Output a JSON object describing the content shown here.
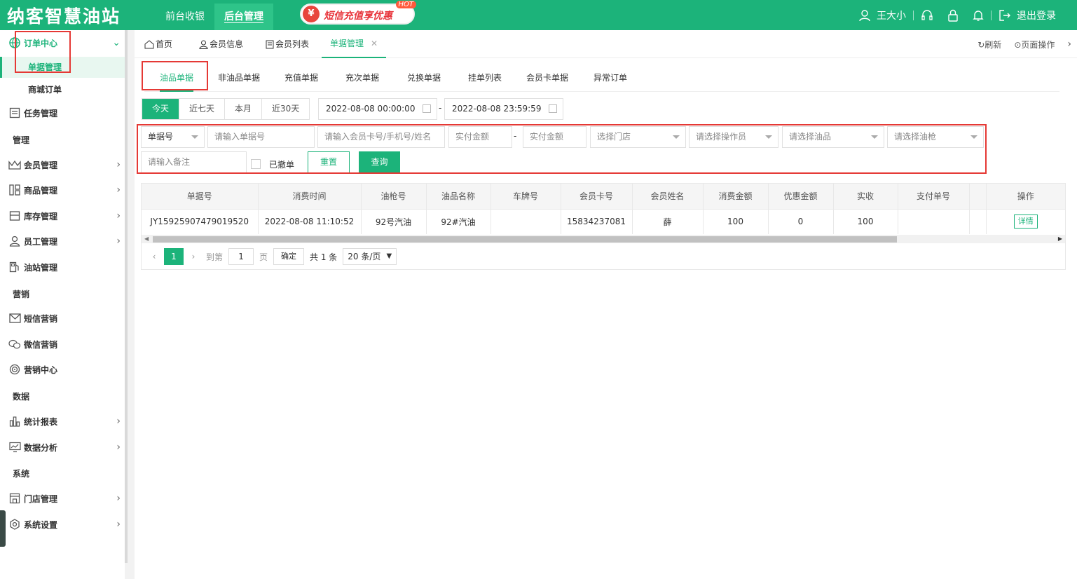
{
  "app": {
    "logo": "纳客智慧油站"
  },
  "topnav": [
    {
      "label": "前台收银"
    },
    {
      "label": "后台管理"
    }
  ],
  "promo": {
    "label": "短信充值享优惠",
    "badge": "HOT"
  },
  "user": {
    "name": "王大小",
    "logout": "退出登录"
  },
  "sidebar": {
    "order_center": "订单中心",
    "order_subs": [
      "单据管理",
      "商城订单"
    ],
    "task": "任务管理",
    "sections": [
      "管理",
      "营销",
      "数据",
      "系统"
    ],
    "manage_items": [
      "会员管理",
      "商品管理",
      "库存管理",
      "员工管理",
      "油站管理"
    ],
    "marketing_items": [
      "短信营销",
      "微信营销",
      "营销中心"
    ],
    "data_items": [
      "统计报表",
      "数据分析"
    ],
    "system_items": [
      "门店管理",
      "系统设置"
    ]
  },
  "tabs": [
    {
      "label": "首页"
    },
    {
      "label": "会员信息"
    },
    {
      "label": "会员列表"
    },
    {
      "label": "单据管理"
    }
  ],
  "tabs_right": {
    "refresh": "刷新",
    "page_ops": "页面操作"
  },
  "subtabs": [
    "油品单据",
    "非油品单据",
    "充值单据",
    "充次单据",
    "兑换单据",
    "挂单列表",
    "会员卡单据",
    "异常订单"
  ],
  "quick_range": [
    "今天",
    "近七天",
    "本月",
    "近30天"
  ],
  "date": {
    "start": "2022-08-08 00:00:00",
    "end": "2022-08-08 23:59:59",
    "sep": "-"
  },
  "filters": {
    "type_select": "单据号",
    "bill_no_ph": "请输入单据号",
    "member_ph": "请输入会员卡号/手机号/姓名",
    "amount_min_ph": "实付金额",
    "amount_sep": "-",
    "amount_max_ph": "实付金额",
    "store_ph": "选择门店",
    "operator_ph": "请选择操作员",
    "oil_ph": "请选择油品",
    "gun_ph": "请选择油枪",
    "remark_ph": "请输入备注",
    "cancelled": "已撤单",
    "reset": "重置",
    "query": "查询"
  },
  "table": {
    "headers": [
      "单据号",
      "消费时间",
      "油枪号",
      "油品名称",
      "车牌号",
      "会员卡号",
      "会员姓名",
      "消费金额",
      "优惠金额",
      "实收",
      "支付单号",
      "",
      "操作"
    ],
    "rows": [
      [
        "JY15925907479019520",
        "2022-08-08 11:10:52",
        "92号汽油",
        "92#汽油",
        "",
        "15834237081",
        "薛",
        "100",
        "0",
        "100",
        "",
        "",
        "详情"
      ]
    ]
  },
  "pager": {
    "current": "1",
    "goto_label": "到第",
    "goto_value": "1",
    "page_unit": "页",
    "confirm": "确定",
    "total": "共 1 条",
    "size": "20 条/页"
  },
  "colors": {
    "brand": "#1cb37a",
    "highlight_box": "#e53935"
  }
}
